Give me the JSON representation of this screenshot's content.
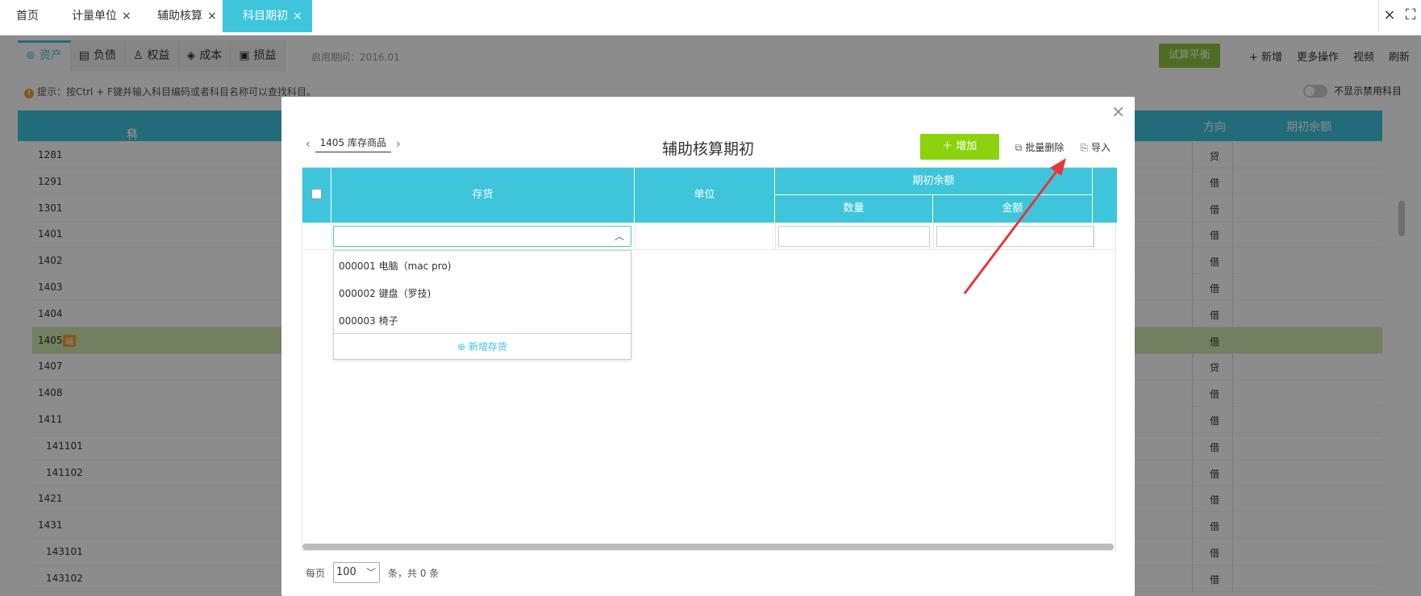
{
  "top_tabs": [
    {
      "label": "首页",
      "closable": false
    },
    {
      "label": "计量单位",
      "closable": true
    },
    {
      "label": "辅助核算",
      "closable": true
    },
    {
      "label": "科目期初",
      "closable": true,
      "active": true
    }
  ],
  "close_glyph": "×",
  "window_controls": {
    "close_icon": "close-icon",
    "fullscreen_icon": "fullscreen-icon"
  },
  "background": {
    "subtabs": [
      {
        "icon": "asset-icon",
        "label": "资产",
        "active": true
      },
      {
        "icon": "debt-icon",
        "label": "负债"
      },
      {
        "icon": "equity-icon",
        "label": "权益"
      },
      {
        "icon": "cost-icon",
        "label": "成本"
      },
      {
        "icon": "profit-loss-icon",
        "label": "损益"
      }
    ],
    "period_text": "启用期间：2016.01",
    "trial_balance_label": "试算平衡",
    "actions": [
      "+ 新增",
      "更多操作",
      "视频",
      "刷新"
    ],
    "tip": "提示：按Ctrl + F键并输入科目编码或者科目名称可以查找科目。",
    "toggle_label": "不显示禁用科目",
    "headers": {
      "code": "科目编码",
      "direction": "方向",
      "opening_balance": "期初余额"
    },
    "rows": [
      {
        "code": "1281",
        "direction": "贷"
      },
      {
        "code": "1291",
        "direction": "借"
      },
      {
        "code": "1301",
        "direction": "借"
      },
      {
        "code": "1401",
        "direction": "借"
      },
      {
        "code": "1402",
        "direction": "借"
      },
      {
        "code": "1403",
        "direction": "借"
      },
      {
        "code": "1404",
        "direction": "借"
      },
      {
        "code": "1405",
        "direction": "借",
        "badge": "辅",
        "highlight": true
      },
      {
        "code": "1407",
        "direction": "贷"
      },
      {
        "code": "1408",
        "direction": "借"
      },
      {
        "code": "1411",
        "direction": "借"
      },
      {
        "code": "141101",
        "direction": "借",
        "indent": true
      },
      {
        "code": "141102",
        "direction": "借",
        "indent": true
      },
      {
        "code": "1421",
        "direction": "借"
      },
      {
        "code": "1431",
        "direction": "借"
      },
      {
        "code": "143101",
        "direction": "借",
        "indent": true
      },
      {
        "code": "143102",
        "direction": "借",
        "indent": true
      }
    ]
  },
  "modal": {
    "title": "辅助核算期初",
    "account": "1405  库存商品",
    "add_label": "＋ 增加",
    "batch_delete_label": "批量删除",
    "import_label": "导入",
    "columns": {
      "inventory": "存货",
      "unit": "单位",
      "opening_balance": "期初余额",
      "quantity": "数量",
      "amount": "金额"
    },
    "inventory_options": [
      "000001 电脑（mac pro)",
      "000002 键盘（罗技)",
      "000003 椅子"
    ],
    "add_inventory_label": "⊕ 新增存货",
    "pager": {
      "per_page_label": "每页",
      "page_size": "100",
      "summary": "条，共 0 条"
    }
  },
  "colors": {
    "accent": "#3ec5dc",
    "green": "#8cd20f",
    "annotation": "#e8353a"
  }
}
